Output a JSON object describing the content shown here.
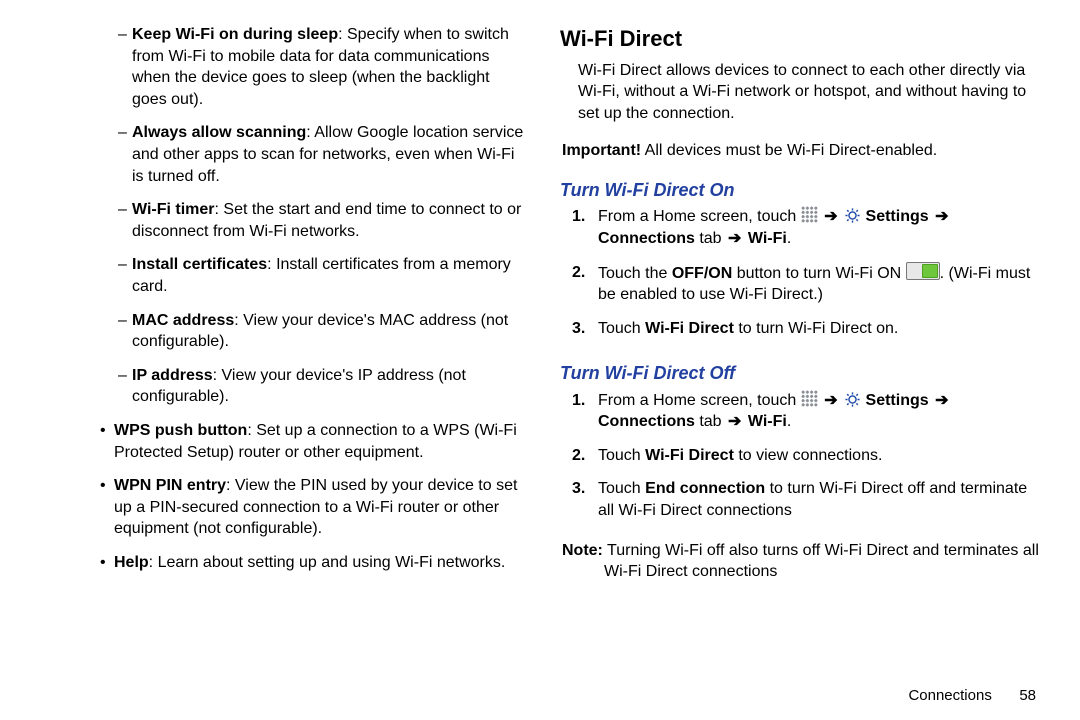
{
  "left": {
    "dash": [
      {
        "term": "Keep Wi-Fi on during sleep",
        "desc": ": Specify when to switch from Wi-Fi to mobile data for data communications when the device goes to sleep (when the backlight goes out)."
      },
      {
        "term": "Always allow scanning",
        "desc": ": Allow Google location service and other apps to scan for networks, even when Wi-Fi is turned off."
      },
      {
        "term": "Wi-Fi timer",
        "desc": ": Set the start and end time to connect to or disconnect from Wi-Fi networks."
      },
      {
        "term": "Install certificates",
        "desc": ": Install certificates from a memory card."
      },
      {
        "term": "MAC address",
        "desc": ": View your device's MAC address (not configurable)."
      },
      {
        "term": "IP address",
        "desc": ": View your device's IP address (not configurable)."
      }
    ],
    "bullets": [
      {
        "term": "WPS push button",
        "desc": ": Set up a connection to a WPS (Wi-Fi Protected Setup) router or other equipment."
      },
      {
        "term": "WPN PIN entry",
        "desc": ": View the PIN used by your device to set up a PIN-secured connection to a Wi-Fi router or other equipment (not configurable)."
      },
      {
        "term": "Help",
        "desc": ": Learn about setting up and using Wi-Fi networks."
      }
    ]
  },
  "right": {
    "heading": "Wi-Fi Direct",
    "intro": "Wi-Fi Direct allows devices to connect to each other directly via Wi-Fi, without a Wi-Fi network or hotspot, and without having to set up the connection.",
    "important_label": "Important!",
    "important_text": " All devices must be Wi-Fi Direct-enabled.",
    "turn_on_heading": "Turn Wi-Fi Direct On",
    "on_steps": {
      "s1_pre": "From a Home screen, touch ",
      "settings_label": "Settings",
      "connections_label": "Connections",
      "tab_text": " tab ",
      "wifi_label": "Wi-Fi",
      "s2_a": "Touch the ",
      "s2_btn": "OFF/ON",
      "s2_b": " button to turn Wi-Fi ON ",
      "s2_c": ". (Wi-Fi must be enabled to use Wi-Fi Direct.)",
      "s3_a": "Touch ",
      "s3_b": "Wi-Fi Direct",
      "s3_c": " to turn Wi-Fi Direct on."
    },
    "turn_off_heading": "Turn Wi-Fi Direct Off",
    "off_steps": {
      "s1_pre": "From a Home screen, touch ",
      "s2_a": "Touch ",
      "s2_b": "Wi-Fi Direct",
      "s2_c": " to view connections.",
      "s3_a": "Touch ",
      "s3_b": "End connection",
      "s3_c": " to turn Wi-Fi Direct off and terminate all Wi-Fi Direct connections"
    },
    "note_label": "Note:",
    "note_text": " Turning Wi-Fi off also turns off Wi-Fi Direct and terminates all Wi-Fi Direct connections",
    "footer_section": "Connections",
    "footer_page": "58"
  },
  "glyphs": {
    "arrow": "➔"
  }
}
